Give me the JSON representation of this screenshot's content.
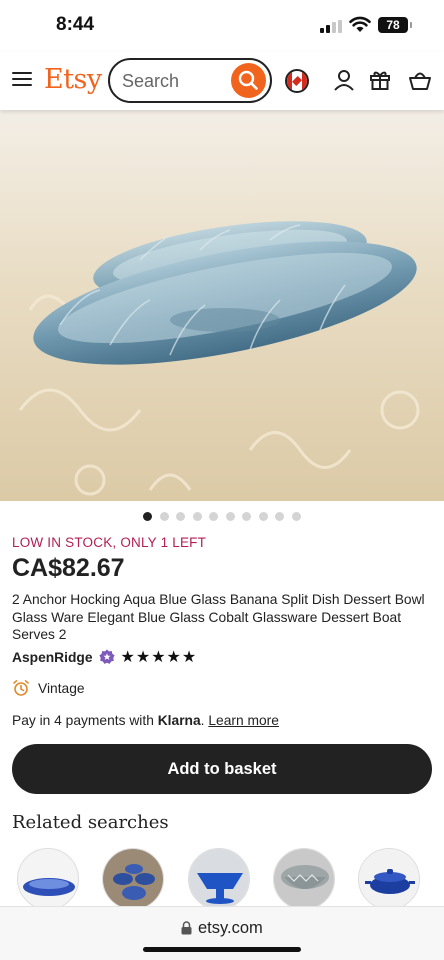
{
  "status_bar": {
    "time": "8:44",
    "battery": "78"
  },
  "header": {
    "logo": "Etsy",
    "search_placeholder": "Search",
    "icons": [
      "menu-icon",
      "search-icon",
      "canada-flag-icon",
      "account-icon",
      "gift-icon",
      "basket-icon"
    ]
  },
  "colors": {
    "brand": "#f1641e",
    "stock_alert": "#b31e54",
    "button": "#222222",
    "star_seller": "#7e5bba"
  },
  "carousel": {
    "image_count": 10,
    "active_index": 0
  },
  "product": {
    "stock_text": "LOW IN STOCK, ONLY 1 LEFT",
    "price": "CA$82.67",
    "title": "2 Anchor Hocking Aqua Blue Glass Banana Split Dish Dessert Bowl Glass Ware Elegant Blue Glass Cobalt Glassware Dessert Boat Serves 2",
    "seller": "AspenRidge",
    "rating": 5,
    "stars": "★★★★★",
    "tag": "Vintage",
    "payment": {
      "prefix": "Pay in 4 payments with",
      "provider": "Klarna",
      "separator": ".",
      "link": "Learn more"
    },
    "cta": "Add to basket"
  },
  "related": {
    "title": "Related searches"
  },
  "browser": {
    "url": "etsy.com"
  }
}
